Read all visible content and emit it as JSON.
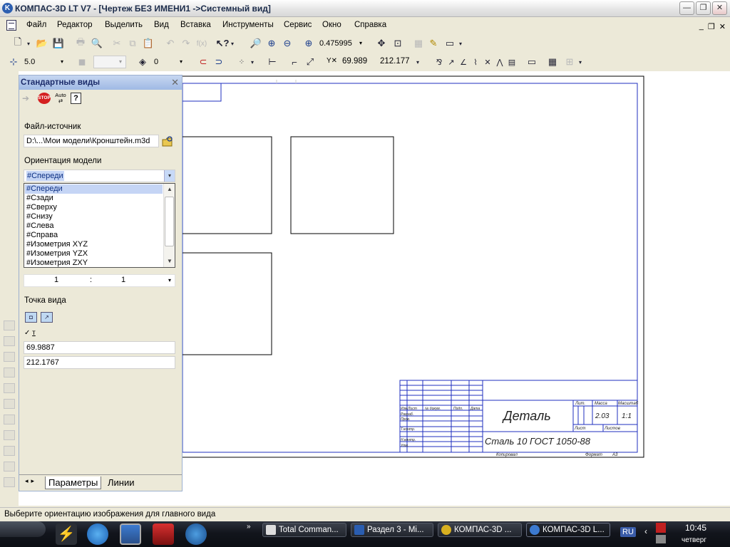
{
  "window": {
    "title": "КОМПАС-3D LT V7 - [Чертеж БЕЗ ИМЕНИ1 ->Системный вид]"
  },
  "menu": [
    "Файл",
    "Редактор",
    "Выделить",
    "Вид",
    "Вставка",
    "Инструменты",
    "Сервис",
    "Окно",
    "Справка"
  ],
  "toolbar1": {
    "zoom_value": "0.475995"
  },
  "toolbar2": {
    "step_value": "5.0",
    "layer_value": "0",
    "x_value": "69.989",
    "y_value": "212.177"
  },
  "panel": {
    "title": "Стандартные виды",
    "stop_label": "STOP",
    "auto_label": "Auto",
    "help_label": "?",
    "source_label": "Файл-источник",
    "source_value": "D:\\...\\Мои модели\\Кронштейн.m3d",
    "orientation_label": "Ориентация модели",
    "orientation_selected": "#Спереди",
    "orientation_options": [
      "#Спереди",
      "#Сзади",
      "#Сверху",
      "#Снизу",
      "#Слева",
      "#Справа",
      "#Изометрия XYZ",
      "#Изометрия YZX",
      "#Изометрия ZXY"
    ],
    "scale_left": "1",
    "scale_sep": ":",
    "scale_right": "1",
    "viewpoint_label": "Точка вида",
    "coord_label": "т",
    "coord_x": "69.9887",
    "coord_y": "212.1767",
    "tab_params": "Параметры",
    "tab_lines": "Линии"
  },
  "title_block": {
    "part_name": "Деталь",
    "material": "Сталь 10  ГОСТ 1050-88",
    "mass": "2.03",
    "scale": "1:1",
    "col_lit": "Лит.",
    "col_mass": "Масса",
    "col_scale": "Масштаб",
    "sheet": "Лист",
    "sheets": "Листов",
    "copied": "Копировал",
    "format": "Формат",
    "format_value": "А3",
    "row_labels": [
      "Изм.",
      "Лист",
      "№ докум.",
      "Подп.",
      "Дата"
    ],
    "left_rows": [
      "Разраб.",
      "Пров.",
      "Т.контр.",
      "Н.контр.",
      "Утв."
    ]
  },
  "status": {
    "message": "Выберите ориентацию изображения для главного вида"
  },
  "taskbar": {
    "tasks": [
      "Total Comman...",
      "Раздел 3 - Mi...",
      "КОМПАС-3D ...",
      "КОМПАС-3D L..."
    ],
    "language": "RU",
    "time": "10:45",
    "day": "четверг"
  }
}
